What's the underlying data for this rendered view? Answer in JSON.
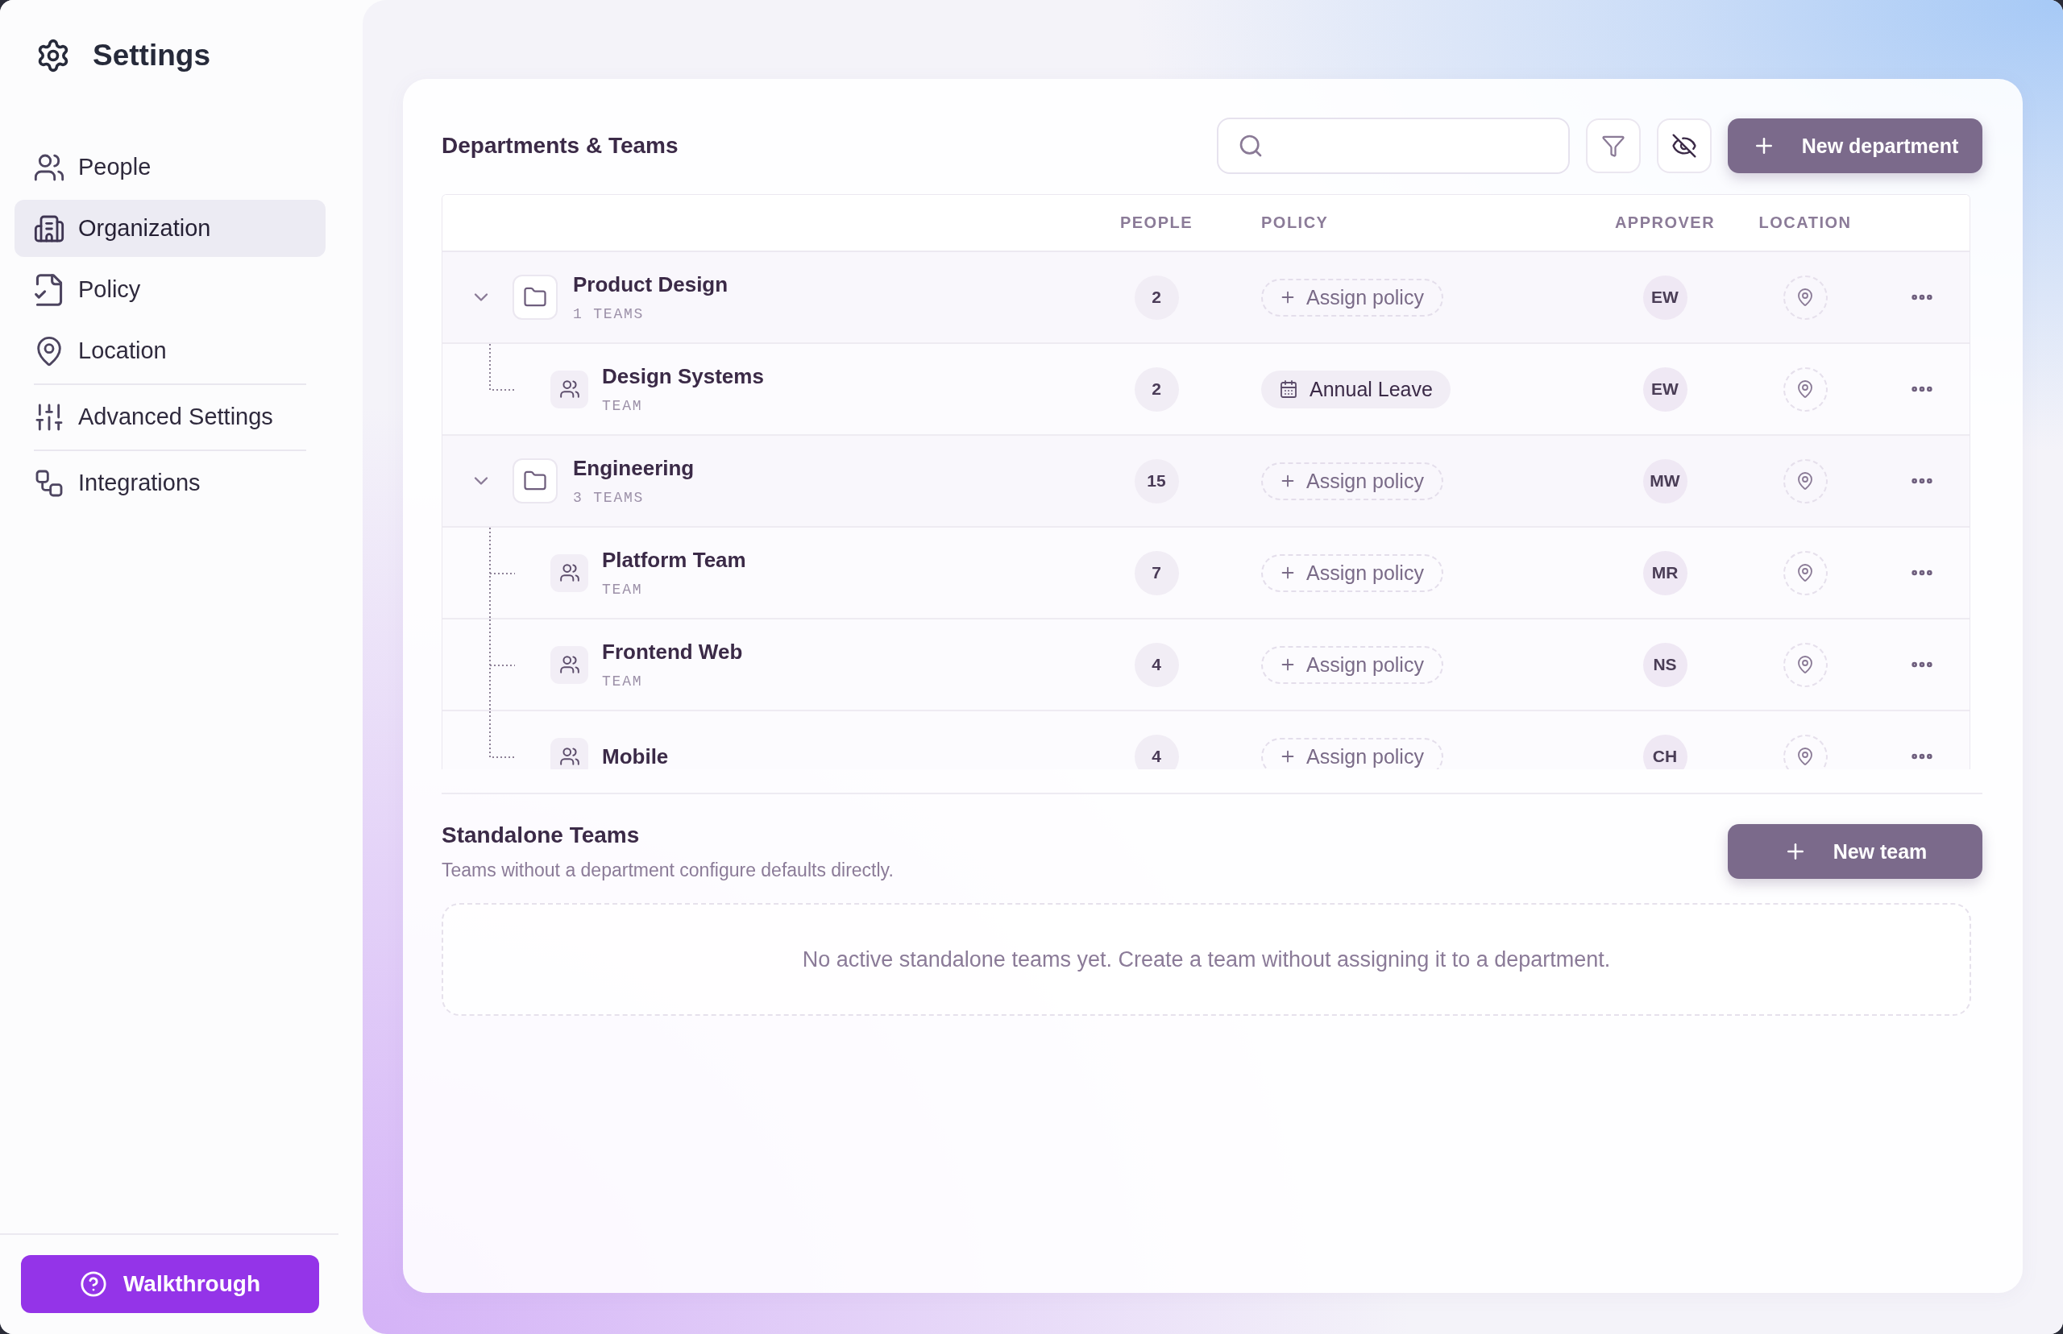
{
  "sidebar": {
    "title": "Settings",
    "groups": [
      {
        "items": [
          {
            "label": "People",
            "selected": false
          },
          {
            "label": "Organization",
            "selected": true
          },
          {
            "label": "Policy",
            "selected": false
          },
          {
            "label": "Location",
            "selected": false
          }
        ]
      },
      {
        "items": [
          {
            "label": "Advanced Settings",
            "selected": false
          }
        ]
      },
      {
        "items": [
          {
            "label": "Integrations",
            "selected": false
          }
        ]
      }
    ],
    "walkthrough_button": "Walkthrough"
  },
  "departments": {
    "title": "Departments & Teams",
    "new_button": "New department",
    "columns": [
      "PEOPLE",
      "POLICY",
      "APPROVER",
      "LOCATION"
    ],
    "rows": [
      {
        "name": "Product Design",
        "subtitle": "1 TEAMS",
        "people": "2",
        "policy": {
          "kind": "add",
          "label": "Assign policy"
        },
        "approver": "EW",
        "expanded": true,
        "children": [
          {
            "name": "Design Systems",
            "subtitle": "TEAM",
            "people": "2",
            "policy": {
              "kind": "assigned",
              "label": "Annual Leave"
            },
            "approver": "EW"
          }
        ]
      },
      {
        "name": "Engineering",
        "subtitle": "3 TEAMS",
        "people": "15",
        "policy": {
          "kind": "add",
          "label": "Assign policy"
        },
        "approver": "MW",
        "expanded": true,
        "children": [
          {
            "name": "Platform Team",
            "subtitle": "TEAM",
            "people": "7",
            "policy": {
              "kind": "add",
              "label": "Assign policy"
            },
            "approver": "MR"
          },
          {
            "name": "Frontend Web",
            "subtitle": "TEAM",
            "people": "4",
            "policy": {
              "kind": "add",
              "label": "Assign policy"
            },
            "approver": "NS"
          },
          {
            "name": "Mobile",
            "people": "4",
            "policy": {
              "kind": "add",
              "label": "Assign policy"
            },
            "approver": "CH"
          }
        ]
      }
    ]
  },
  "standalone_teams": {
    "title": "Standalone Teams",
    "description": "Teams without a department configure defaults directly.",
    "new_button": "New team",
    "empty_message": "No active standalone teams yet. Create a team without assigning it to a department."
  }
}
